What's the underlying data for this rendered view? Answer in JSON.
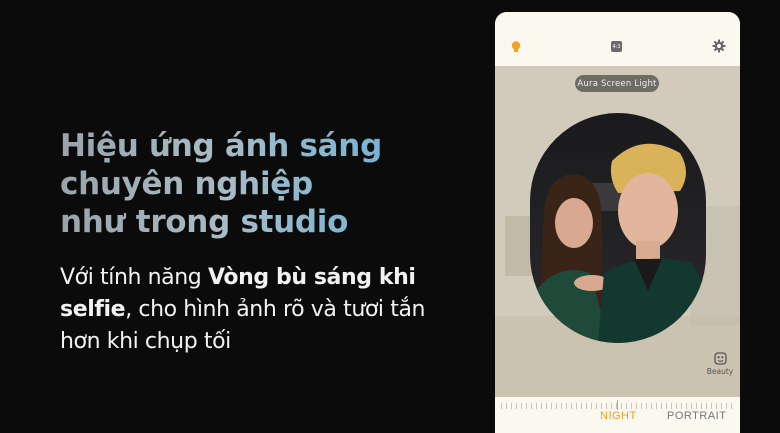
{
  "promo": {
    "headline_line1": "Hiệu ứng ánh sáng",
    "headline_line2": "chuyên nghiệp",
    "headline_line3": "như trong studio",
    "body_pre": "Với tính năng ",
    "body_bold": "Vòng bù sáng khi selfie",
    "body_post": ", cho hình ảnh rõ và tươi tắn hơn khi chụp tối"
  },
  "camera": {
    "top_icons": [
      "bulb-icon",
      "aspect-ratio-icon",
      "gear-icon"
    ],
    "aspect_ratio": "4:3",
    "aura_label": "Aura Screen Light",
    "beauty_label": "Beauty",
    "modes": [
      {
        "label": "NIGHT",
        "active": true
      },
      {
        "label": "PORTRAIT",
        "active": false
      }
    ]
  },
  "colors": {
    "background": "#0b0b0b",
    "accent": "#e8a020",
    "headline_gradient_end": "#6ab2d8"
  }
}
